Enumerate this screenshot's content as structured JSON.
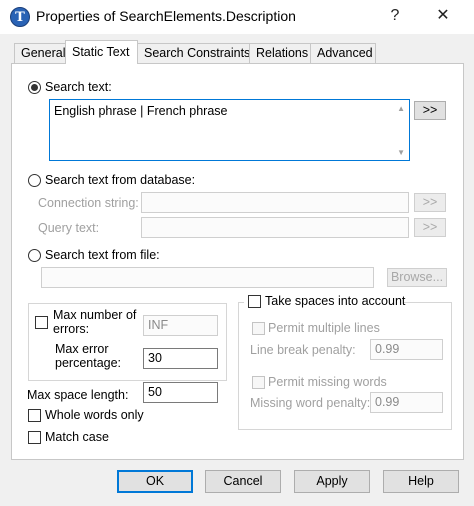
{
  "window": {
    "title": "Properties of SearchElements.Description",
    "icon_letter": "T",
    "help_glyph": "?",
    "close_glyph": "✕"
  },
  "tabs": [
    {
      "label": "General"
    },
    {
      "label": "Static Text"
    },
    {
      "label": "Search Constraints"
    },
    {
      "label": "Relations"
    },
    {
      "label": "Advanced"
    }
  ],
  "search_text": {
    "label": "Search text:",
    "value": "English phrase | French phrase",
    "browse_label": ">>"
  },
  "database": {
    "label": "Search text from database:",
    "connection_label": "Connection string:",
    "query_label": "Query text:",
    "browse_label": ">>"
  },
  "file": {
    "label": "Search text from file:",
    "browse_label": "Browse..."
  },
  "errors": {
    "max_errors_label_line1": "Max number of",
    "max_errors_label_line2": "errors:",
    "max_errors_value": "INF",
    "max_error_pct_label_line1": "Max error",
    "max_error_pct_label_line2": "percentage:",
    "max_error_pct_value": "30"
  },
  "spacing": {
    "max_space_label": "Max space length:",
    "max_space_value": "50",
    "whole_words_label": "Whole words only",
    "match_case_label": "Match case"
  },
  "spaces_group": {
    "take_spaces_label": "Take spaces into account",
    "permit_lines_label": "Permit multiple lines",
    "line_break_label": "Line break penalty:",
    "line_break_value": "0.99",
    "permit_missing_label": "Permit missing words",
    "missing_word_label": "Missing word penalty:",
    "missing_word_value": "0.99"
  },
  "buttons": {
    "ok": "OK",
    "cancel": "Cancel",
    "apply": "Apply",
    "help": "Help"
  },
  "colors": {
    "accent": "#0078d7",
    "panel": "#ffffff",
    "dialog": "#f0f0f0"
  }
}
